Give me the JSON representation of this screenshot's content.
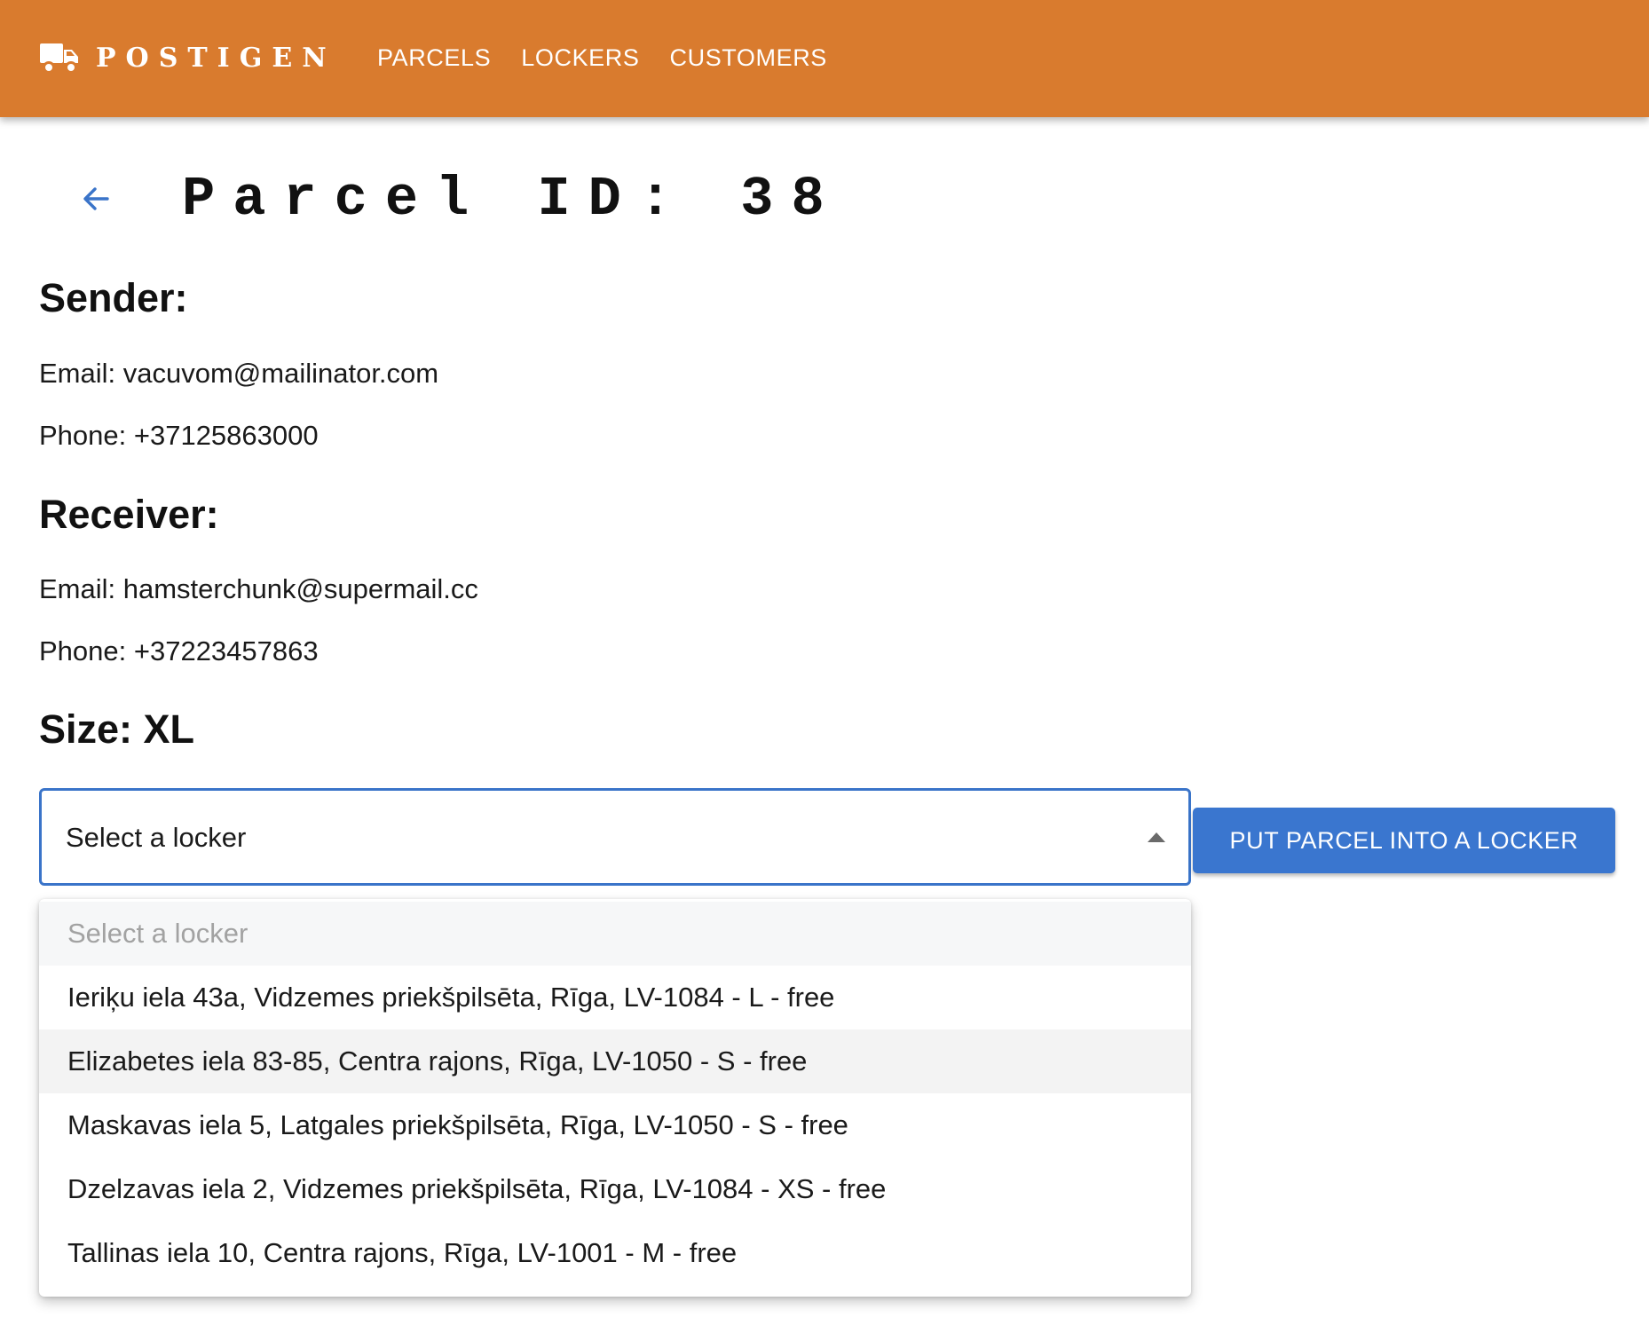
{
  "header": {
    "brand": "POSTIGEN",
    "nav": [
      {
        "label": "PARCELS"
      },
      {
        "label": "LOCKERS"
      },
      {
        "label": "CUSTOMERS"
      }
    ]
  },
  "page": {
    "title": "Parcel ID: 38"
  },
  "sender": {
    "heading": "Sender:",
    "email": "Email: vacuvom@mailinator.com",
    "phone": "Phone: +37125863000"
  },
  "receiver": {
    "heading": "Receiver:",
    "email": "Email: hamsterchunk@supermail.cc",
    "phone": "Phone: +37223457863"
  },
  "size": {
    "heading": "Size: XL"
  },
  "locker_select": {
    "selected": "Select a locker",
    "open": true,
    "options": [
      {
        "label": "Select a locker"
      },
      {
        "label": "Ieriķu iela 43a, Vidzemes priekšpilsēta, Rīga, LV-1084 - L - free"
      },
      {
        "label": "Elizabetes iela 83-85, Centra rajons, Rīga, LV-1050 - S - free"
      },
      {
        "label": "Maskavas iela 5, Latgales priekšpilsēta, Rīga, LV-1050 - S - free"
      },
      {
        "label": "Dzelzavas iela 2, Vidzemes priekšpilsēta, Rīga, LV-1084 - XS - free"
      },
      {
        "label": "Tallinas iela 10, Centra rajons, Rīga, LV-1001 - M - free"
      }
    ]
  },
  "actions": {
    "put_into_locker": "PUT PARCEL INTO A LOCKER"
  },
  "colors": {
    "header_bg": "#d97b2e",
    "accent": "#3a76cf"
  }
}
